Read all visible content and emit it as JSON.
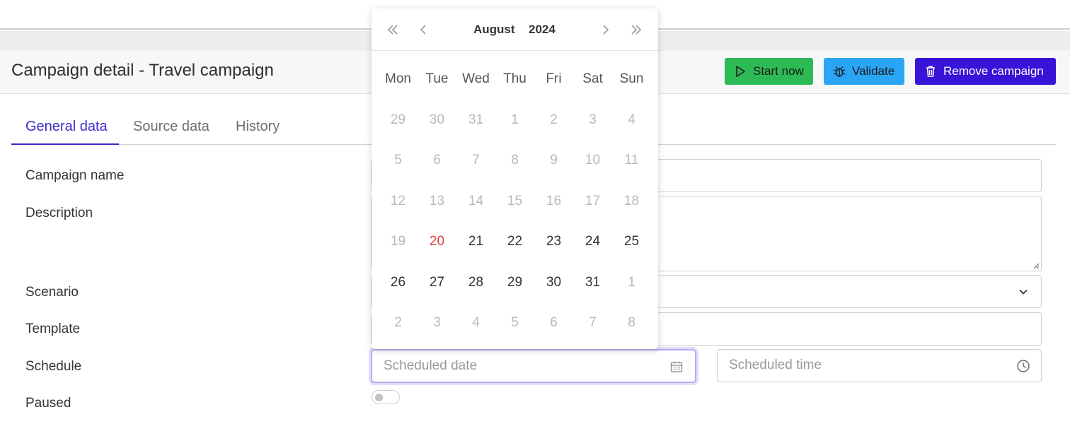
{
  "header": {
    "title": "Campaign detail - Travel campaign",
    "buttons": {
      "start": "Start now",
      "validate": "Validate",
      "remove": "Remove campaign"
    }
  },
  "tabs": [
    {
      "label": "General data",
      "active": true
    },
    {
      "label": "Source data",
      "active": false
    },
    {
      "label": "History",
      "active": false
    }
  ],
  "form": {
    "labels": {
      "campaign_name": "Campaign name",
      "description": "Description",
      "scenario": "Scenario",
      "template": "Template",
      "schedule": "Schedule",
      "paused": "Paused"
    },
    "schedule": {
      "date_placeholder": "Scheduled date",
      "time_placeholder": "Scheduled time"
    },
    "paused": false
  },
  "datepicker": {
    "month": "August",
    "year": "2024",
    "weekdays": [
      "Mon",
      "Tue",
      "Wed",
      "Thu",
      "Fri",
      "Sat",
      "Sun"
    ],
    "weeks": [
      [
        "29",
        "30",
        "31",
        "1",
        "2",
        "3",
        "4"
      ],
      [
        "5",
        "6",
        "7",
        "8",
        "9",
        "10",
        "11"
      ],
      [
        "12",
        "13",
        "14",
        "15",
        "16",
        "17",
        "18"
      ],
      [
        "19",
        "20",
        "21",
        "22",
        "23",
        "24",
        "25"
      ],
      [
        "26",
        "27",
        "28",
        "29",
        "30",
        "31",
        "1"
      ],
      [
        "2",
        "3",
        "4",
        "5",
        "6",
        "7",
        "8"
      ]
    ],
    "today": "20",
    "colors": {
      "today": "#e04040",
      "accent": "#3714d8"
    }
  },
  "icons": {
    "start": "play-icon",
    "validate": "bug-icon",
    "remove": "trash-icon",
    "date": "calendar-icon",
    "time": "clock-icon",
    "scenario": "chevron-down-icon"
  }
}
